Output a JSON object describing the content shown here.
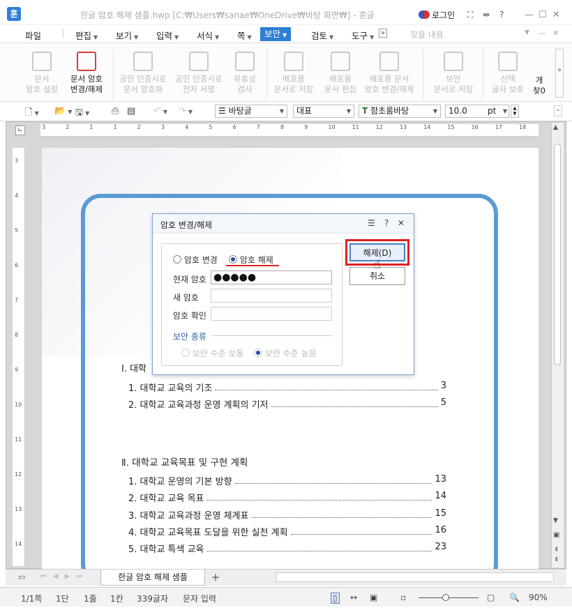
{
  "titlebar": {
    "app_icon": "훈",
    "title": "한글 암호 해제 샘플.hwp [C:₩Users₩sanae₩OneDrive₩바탕 화면₩] - 훈글",
    "login": "로그인",
    "help": "?"
  },
  "menu": [
    "파일",
    "편집",
    "보기",
    "입력",
    "서식",
    "쪽",
    "보안",
    "검토",
    "도구"
  ],
  "menu_search_placeholder": "찾을 내용",
  "ribbon": [
    {
      "l1": "문서",
      "l2": "암호 설정",
      "on": false
    },
    {
      "l1": "문서 암호",
      "l2": "변경/해제",
      "on": true
    },
    {
      "l1": "공인 인증서로",
      "l2": "문서 암호화",
      "on": false
    },
    {
      "l1": "공인 인증서로",
      "l2": "전자 서명",
      "on": false
    },
    {
      "l1": "유효성",
      "l2": "검사",
      "on": false
    },
    {
      "l1": "배포용",
      "l2": "문서로 저장",
      "on": false
    },
    {
      "l1": "배포용",
      "l2": "문서 편집",
      "on": false
    },
    {
      "l1": "배포용 문서",
      "l2": "암호 변경/해제",
      "on": false
    },
    {
      "l1": "보안",
      "l2": "문서로 저장",
      "on": false
    },
    {
      "l1": "선택",
      "l2": "글자 보호",
      "on": false
    },
    {
      "l1": "개",
      "l2": "찾0",
      "on": true
    }
  ],
  "format": {
    "style": "바탕글",
    "lang": "대표",
    "font": "함초롬바탕",
    "size": "10.0",
    "unit": "pt"
  },
  "ruler_h": [
    "3",
    "2",
    "1",
    "1",
    "2",
    "3",
    "4",
    "5",
    "6",
    "7",
    "8",
    "9",
    "10",
    "11",
    "12",
    "13",
    "14",
    "15",
    "16",
    "17",
    "18"
  ],
  "ruler_v": [
    "3",
    "4",
    "5",
    "6",
    "7",
    "8",
    "9",
    "10",
    "11",
    "12",
    "13",
    "14"
  ],
  "doc": {
    "sec1_heading": "Ⅰ. 대학",
    "sec1_items": [
      {
        "text": "1. 대학교 교육의 기조",
        "page": "3"
      },
      {
        "text": "2. 대학교 교육과정 운영 계획의 기저",
        "page": "5"
      }
    ],
    "sec2_heading": "Ⅱ. 대학교 교육목표 및 구현 계획",
    "sec2_items": [
      {
        "text": "1. 대학교 운영의 기본 방향",
        "page": "13"
      },
      {
        "text": "2. 대학교 교육 목표",
        "page": "14"
      },
      {
        "text": "3. 대학교 교육과정 운영 체계표",
        "page": "15"
      },
      {
        "text": "4. 대학교 교육목표 도달을 위한 실천 계획",
        "page": "16"
      },
      {
        "text": "5. 대학교 특색 교육",
        "page": "23"
      }
    ]
  },
  "dialog": {
    "title": "암호 변경/해제",
    "radio_change": "암호 변경",
    "radio_release": "암호 해제",
    "current_label": "현재 암호",
    "current_value": "●●●●●",
    "new_label": "새 암호",
    "confirm_label": "암호 확인",
    "security_label": "보안 종류",
    "level_normal": "보안 수준 보통",
    "level_high": "보안 수준 높음",
    "ok": "해제(D)",
    "cancel": "취소"
  },
  "tabs": {
    "doc_tab": "한글 암호 해제 샘플"
  },
  "status": {
    "page": "1/1쪽",
    "section": "1단",
    "line": "1줄",
    "col": "1칸",
    "chars": "339글자",
    "mode": "문자 입력",
    "zoom": "90%"
  },
  "colors": {
    "accent": "#2d7fd6",
    "frame": "#5b9bd5",
    "highlight": "#e02020"
  }
}
